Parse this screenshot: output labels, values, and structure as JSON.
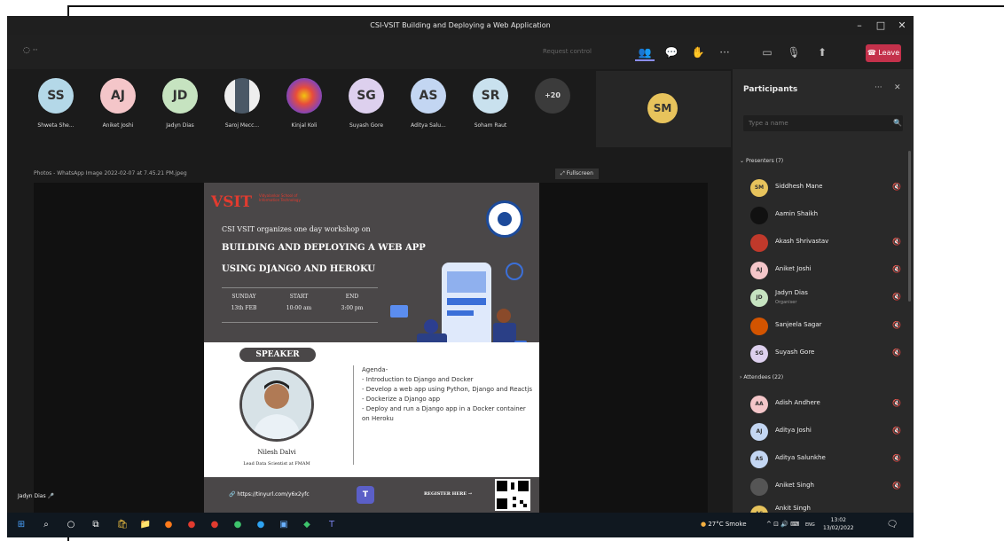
{
  "window": {
    "title": "CSI-VSIT Building and Deploying a Web Application"
  },
  "toolbar": {
    "request_control": "Request control",
    "leave_label": "Leave"
  },
  "tiles": [
    {
      "initials": "SS",
      "name": "Shweta She...",
      "color": "#b4d8e8"
    },
    {
      "initials": "AJ",
      "name": "Aniket Joshi",
      "color": "#f4c6c9"
    },
    {
      "initials": "JD",
      "name": "Jadyn Dias",
      "color": "#c6e3c0"
    },
    {
      "initials": "",
      "name": "Saroj Mecc...",
      "color": "#6b7b8c"
    },
    {
      "initials": "",
      "name": "Kinjal Koli",
      "color": "#8e44ad"
    },
    {
      "initials": "SG",
      "name": "Suyash Gore",
      "color": "#ddd0ee"
    },
    {
      "initials": "AS",
      "name": "Aditya Salu...",
      "color": "#c3d6f2"
    },
    {
      "initials": "SR",
      "name": "Soham Raut",
      "color": "#c9e1ee"
    },
    {
      "initials": "+20",
      "name": "",
      "color": "#3b3b3b"
    }
  ],
  "spotlight": {
    "initials": "SM"
  },
  "share": {
    "file": "Photos - WhatsApp Image 2022-02-07 at 7.45.21 PM.jpeg",
    "fullscreen": "Fullscreen"
  },
  "poster": {
    "logo": "VSIT",
    "logo_sub": "Vidyalankar School of Information Technology",
    "intro": "CSI VSIT organizes one day workshop on",
    "title_line1": "BUILDING AND DEPLOYING A WEB APP",
    "title_line2": "USING DJANGO AND HEROKU",
    "schedule": [
      {
        "head": "SUNDAY",
        "value": "13th FEB"
      },
      {
        "head": "START",
        "value": "10:00 am"
      },
      {
        "head": "END",
        "value": "3:00 pm"
      }
    ],
    "speaker_label": "SPEAKER",
    "speaker_name": "Nilesh Dalvi",
    "speaker_role": "Lead Data Scientist at FMAM",
    "agenda_title": "Agenda-",
    "agenda": [
      "- Introduction to Django and Docker",
      "- Develop a web app using Python, Django and Reactjs",
      "- Dockerize a Django app",
      "- Deploy and run a Django app in a Docker container on Heroku"
    ],
    "url": "https://tinyurl.com/y6x2yfc",
    "register": "REGISTER HERE →"
  },
  "self_label": "Jadyn Dias",
  "panel": {
    "title": "Participants",
    "search_placeholder": "Type a name",
    "presenters_label": "Presenters (7)",
    "attendees_label": "Attendees (22)",
    "presenters": [
      {
        "initials": "SM",
        "name": "Siddhesh Mane",
        "sub": "",
        "color": "#e7c35c"
      },
      {
        "initials": "",
        "name": "Aamin Shaikh",
        "sub": "",
        "color": "#111111"
      },
      {
        "initials": "",
        "name": "Akash Shrivastav",
        "sub": "",
        "color": "#c0392b"
      },
      {
        "initials": "AJ",
        "name": "Aniket Joshi",
        "sub": "",
        "color": "#f4c6c9"
      },
      {
        "initials": "JD",
        "name": "Jadyn Dias",
        "sub": "Organiser",
        "color": "#c6e3c0"
      },
      {
        "initials": "",
        "name": "Sanjeela Sagar",
        "sub": "",
        "color": "#d35400"
      },
      {
        "initials": "SG",
        "name": "Suyash Gore",
        "sub": "",
        "color": "#ddd0ee"
      }
    ],
    "attendees": [
      {
        "initials": "AA",
        "name": "Adish Andhere",
        "sub": "",
        "color": "#f4c6c9"
      },
      {
        "initials": "AJ",
        "name": "Aditya Joshi",
        "sub": "",
        "color": "#c3d6f2"
      },
      {
        "initials": "AS",
        "name": "Aditya Salunkhe",
        "sub": "",
        "color": "#c3d6f2"
      },
      {
        "initials": "",
        "name": "Aniket Singh",
        "sub": "",
        "color": "#555555"
      },
      {
        "initials": "AS",
        "name": "Ankit Singh",
        "sub": "",
        "color": "#e7c35c"
      }
    ]
  },
  "taskbar": {
    "weather": "27°C Smoke",
    "lang": "ENG",
    "time": "13:02",
    "date": "13/02/2022"
  }
}
